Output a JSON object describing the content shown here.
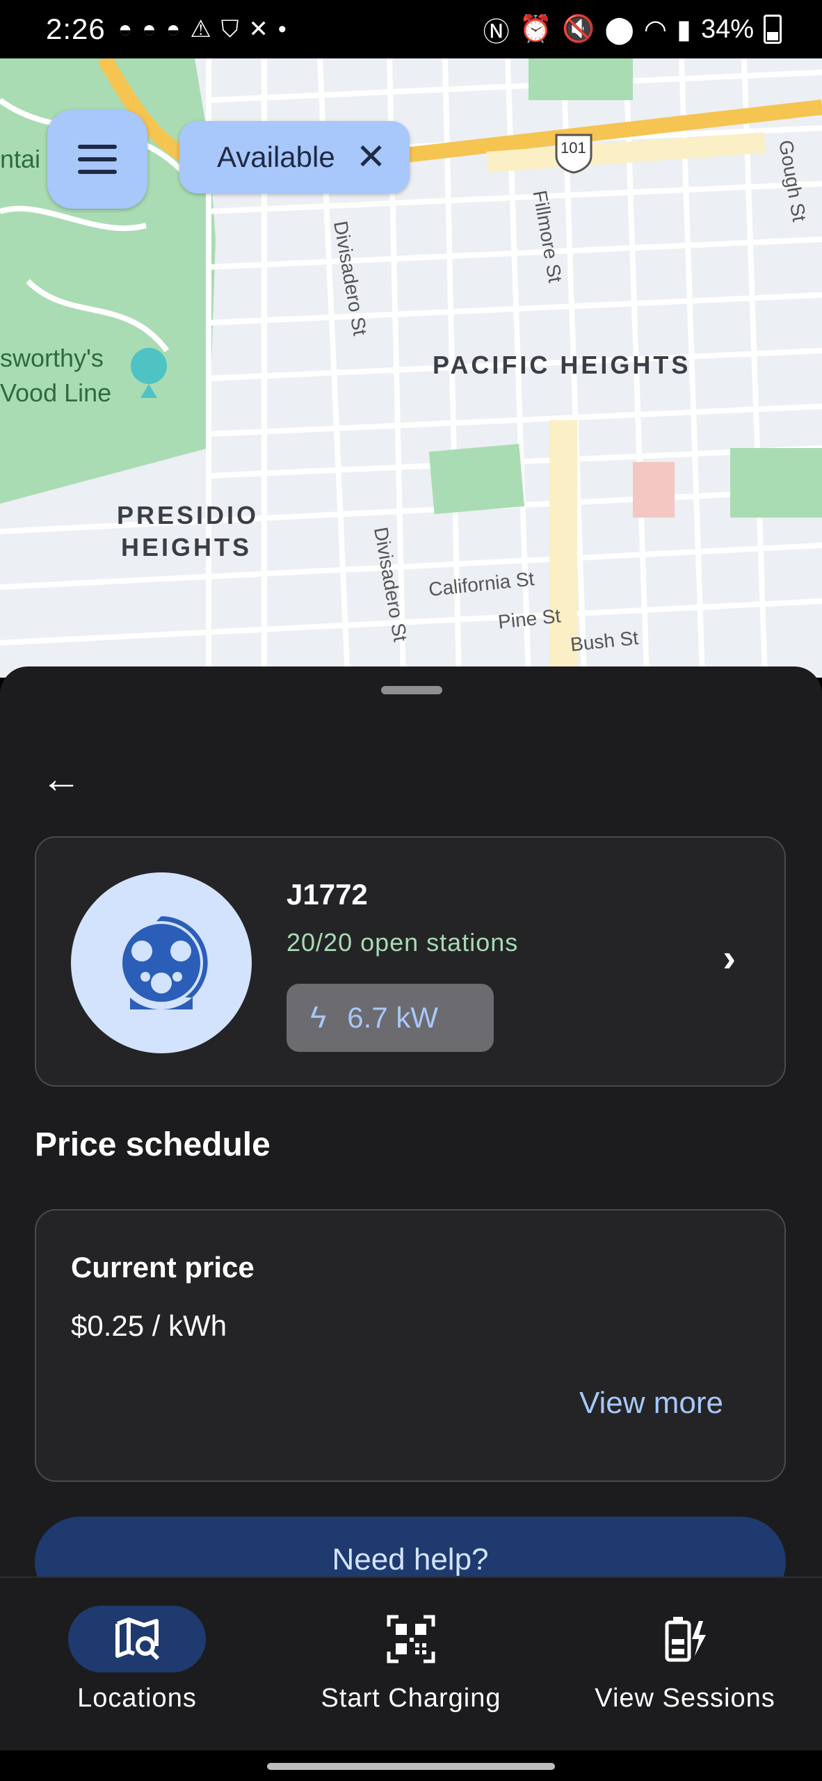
{
  "status_bar": {
    "time": "2:26",
    "battery": "34%",
    "left_icons": [
      "discord-icon",
      "discord-icon",
      "discord-icon",
      "warning-icon",
      "shield-icon",
      "tools-icon",
      "dot-icon"
    ],
    "right_icons": [
      "nfc-icon",
      "alarm-icon",
      "mute-icon",
      "location-icon",
      "wifi-icon",
      "signal-icon",
      "battery-icon"
    ]
  },
  "map": {
    "labels": {
      "pacific_heights": "PACIFIC HEIGHTS",
      "presidio_heights_1": "PRESIDIO",
      "presidio_heights_2": "HEIGHTS",
      "lyon_1": "sworthy's",
      "lyon_2": "Vood Line",
      "mountain": "ntai"
    },
    "streets": {
      "divisadero_1": "Divisadero St",
      "divisadero_2": "Divisadero St",
      "fillmore": "Fillmore St",
      "gough": "Gough St",
      "california": "California St",
      "pine": "Pine St",
      "bush": "Bush St",
      "highway": "101"
    }
  },
  "filter_chip": {
    "label": "Available",
    "close": "✕"
  },
  "connector": {
    "title": "J1772",
    "open_stations": "20/20 open stations",
    "power": "6.7 kW"
  },
  "price": {
    "section_title": "Price schedule",
    "label": "Current price",
    "value": "$0.25 / kWh",
    "view_more": "View more"
  },
  "help_button": "Need help?",
  "nav": {
    "locations": "Locations",
    "start_charging": "Start Charging",
    "view_sessions": "View Sessions"
  },
  "colors": {
    "accent": "#a8c7fa",
    "sheet_bg": "#1c1c1e",
    "open_green": "#a8dab5",
    "nav_active": "#1f3a6e"
  }
}
